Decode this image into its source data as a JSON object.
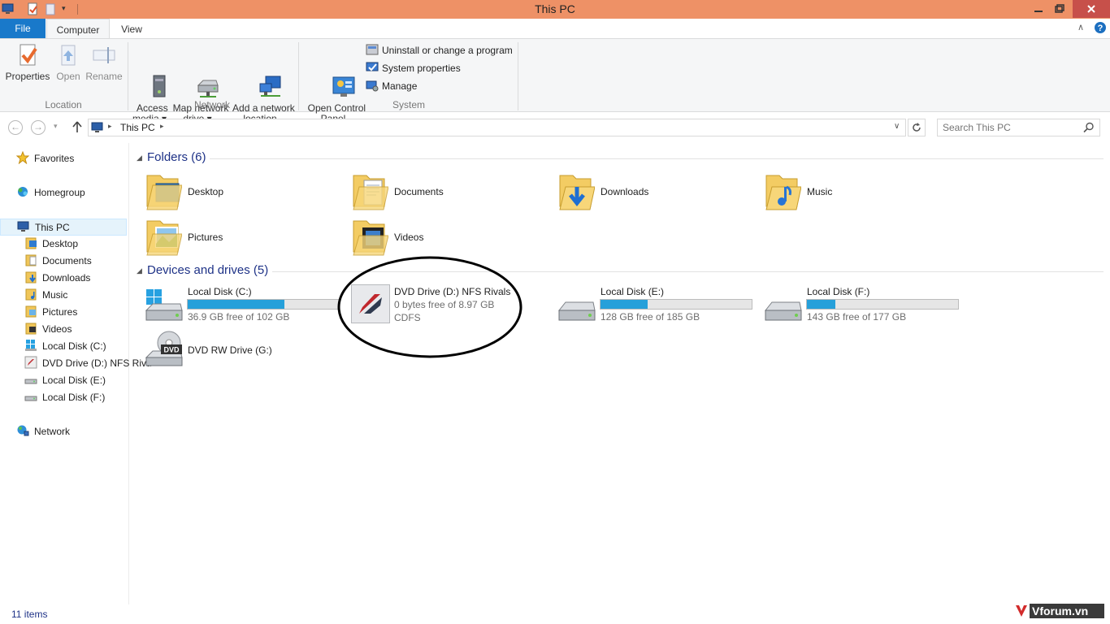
{
  "window": {
    "title": "This PC"
  },
  "ribbon": {
    "tabs": {
      "file": "File",
      "computer": "Computer",
      "view": "View"
    },
    "location": {
      "label": "Location",
      "properties": "Properties",
      "open": "Open",
      "rename": "Rename"
    },
    "network": {
      "label": "Network",
      "access_media": "Access\nmedia ▾",
      "map_drive": "Map network\ndrive ▾",
      "add_location": "Add a network\nlocation"
    },
    "system": {
      "label": "System",
      "control_panel": "Open Control\nPanel",
      "uninstall": "Uninstall or change a program",
      "sys_props": "System properties",
      "manage": "Manage"
    }
  },
  "address": {
    "path": "This PC",
    "search_placeholder": "Search This PC"
  },
  "nav": {
    "favorites": "Favorites",
    "homegroup": "Homegroup",
    "this_pc": "This PC",
    "children": [
      "Desktop",
      "Documents",
      "Downloads",
      "Music",
      "Pictures",
      "Videos",
      "Local Disk (C:)",
      "DVD Drive (D:) NFS Rivals",
      "Local Disk (E:)",
      "Local Disk (F:)"
    ],
    "network": "Network"
  },
  "folders": {
    "header": "Folders (6)",
    "items": [
      "Desktop",
      "Documents",
      "Downloads",
      "Music",
      "Pictures",
      "Videos"
    ]
  },
  "drives": {
    "header": "Devices and drives (5)",
    "c": {
      "name": "Local Disk (C:)",
      "free": "36.9 GB free of 102 GB",
      "used_fraction": 0.64
    },
    "d": {
      "name": "DVD Drive (D:) NFS Rivals",
      "free": "0 bytes free of 8.97 GB",
      "fs": "CDFS"
    },
    "e": {
      "name": "Local Disk (E:)",
      "free": "128 GB free of 185 GB",
      "used_fraction": 0.31
    },
    "f": {
      "name": "Local Disk (F:)",
      "free": "143 GB free of 177 GB",
      "used_fraction": 0.19
    },
    "g": {
      "name": "DVD RW Drive (G:)"
    }
  },
  "status": {
    "items": "11 items"
  },
  "watermark": {
    "text": "Vforum.vn"
  }
}
